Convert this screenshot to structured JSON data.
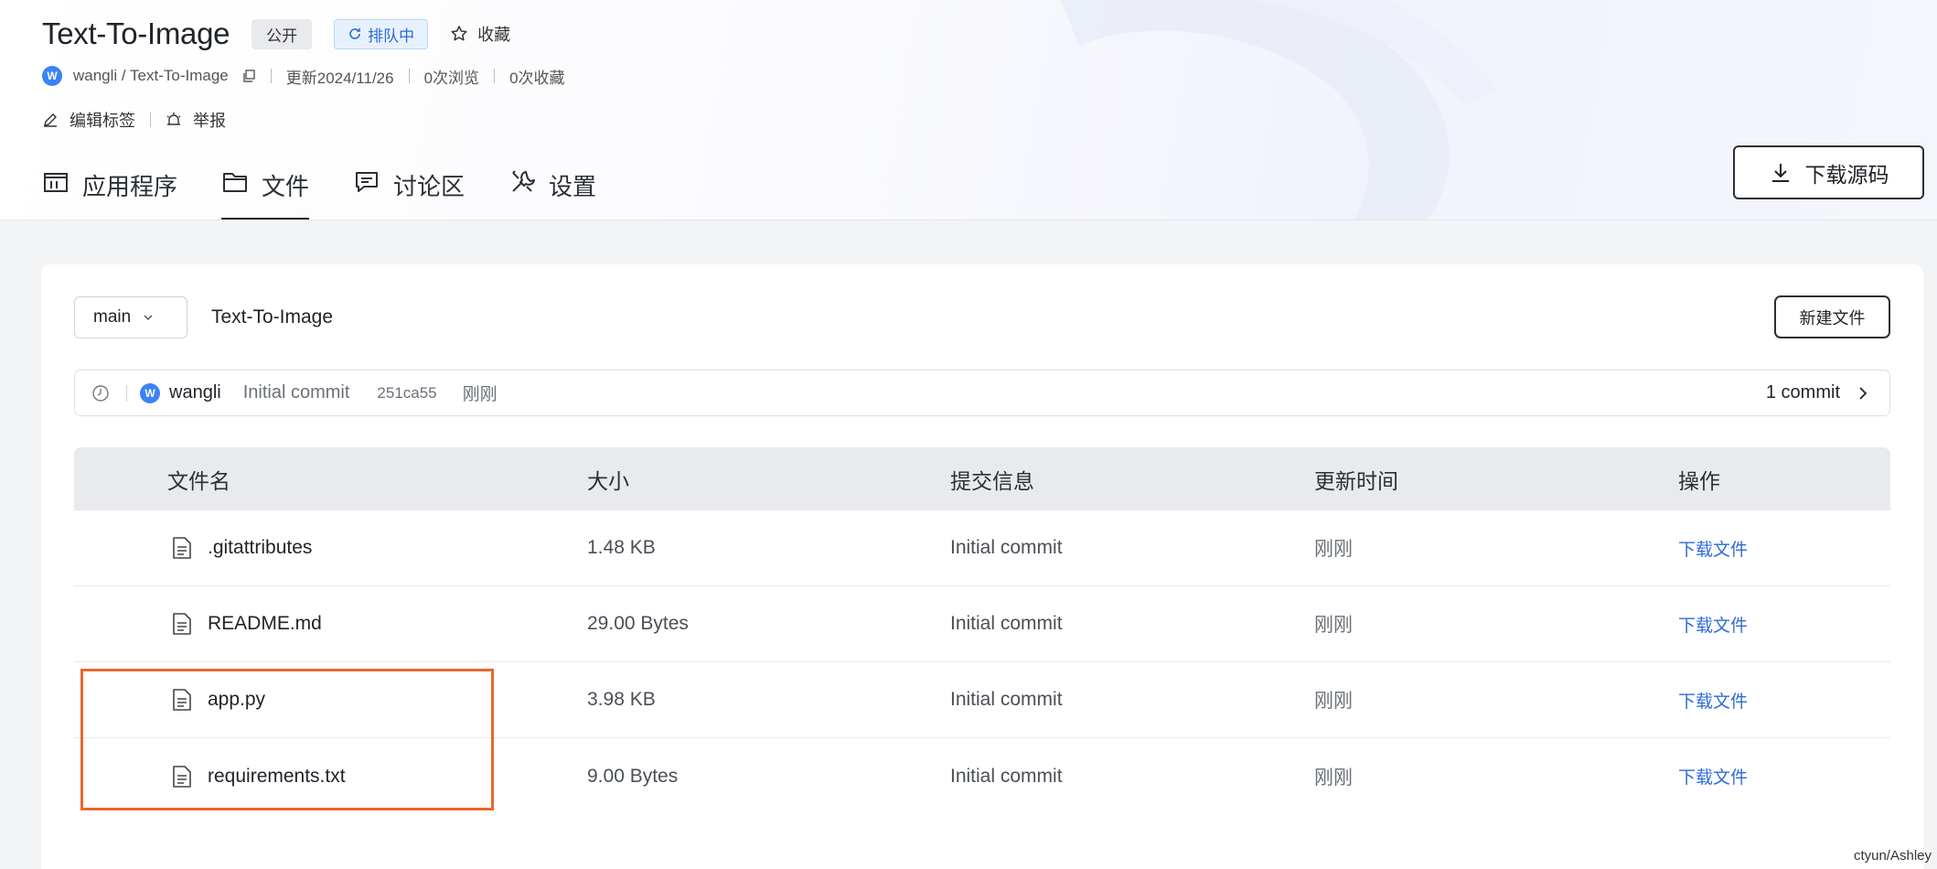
{
  "repo": {
    "title": "Text-To-Image",
    "visibility_badge": "公开",
    "status_badge": "排队中",
    "favorite_label": "收藏"
  },
  "meta": {
    "avatar_letter": "W",
    "path": "wangli / Text-To-Image",
    "updated": "更新2024/11/26",
    "views": "0次浏览",
    "favorites": "0次收藏"
  },
  "actions": {
    "edit_tags": "编辑标签",
    "report": "举报"
  },
  "tabs": [
    {
      "label": "应用程序",
      "icon": "app-icon"
    },
    {
      "label": "文件",
      "icon": "folder-icon",
      "active": true
    },
    {
      "label": "讨论区",
      "icon": "chat-icon"
    },
    {
      "label": "设置",
      "icon": "settings-icon"
    }
  ],
  "download_source_label": "下载源码",
  "files_panel": {
    "branch": "main",
    "breadcrumb": "Text-To-Image",
    "new_file_label": "新建文件",
    "commit": {
      "avatar_letter": "W",
      "user": "wangli",
      "message": "Initial commit",
      "hash": "251ca55",
      "time": "刚刚",
      "count": "1 commit"
    },
    "columns": [
      "文件名",
      "大小",
      "提交信息",
      "更新时间",
      "操作"
    ],
    "rows": [
      {
        "name": ".gitattributes",
        "size": "1.48 KB",
        "message": "Initial commit",
        "time": "刚刚",
        "action": "下载文件"
      },
      {
        "name": "README.md",
        "size": "29.00 Bytes",
        "message": "Initial commit",
        "time": "刚刚",
        "action": "下载文件"
      },
      {
        "name": "app.py",
        "size": "3.98 KB",
        "message": "Initial commit",
        "time": "刚刚",
        "action": "下载文件"
      },
      {
        "name": "requirements.txt",
        "size": "9.00 Bytes",
        "message": "Initial commit",
        "time": "刚刚",
        "action": "下载文件"
      }
    ]
  },
  "watermark": "ctyun/Ashley",
  "colors": {
    "accent_link": "#2f6bd9",
    "highlight_box": "#e8692c",
    "avatar": "#3b82f6"
  }
}
